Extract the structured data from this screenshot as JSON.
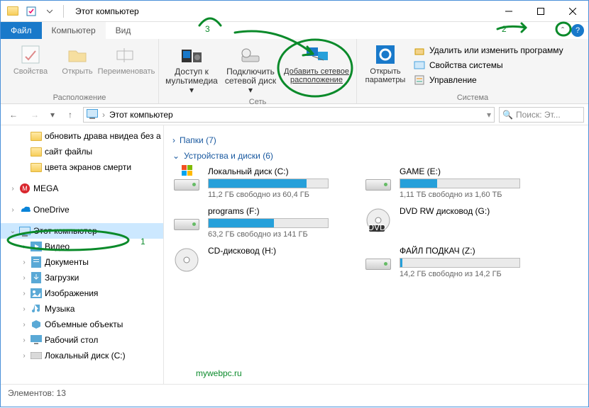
{
  "title": "Этот компьютер",
  "ribbonTabs": {
    "file": "Файл",
    "computer": "Компьютер",
    "view": "Вид"
  },
  "ribbon": {
    "group1": {
      "label": "Расположение",
      "props": "Свойства",
      "open": "Открыть",
      "rename": "Переименовать"
    },
    "group2": {
      "label": "Сеть",
      "media": "Доступ к мультимедиа",
      "mapdrive": "Подключить сетевой диск",
      "addloc": "Добавить сетевое расположение"
    },
    "group3": {
      "label": "Система",
      "settings": "Открыть параметры",
      "uninstall": "Удалить или изменить программу",
      "sysprops": "Свойства системы",
      "manage": "Управление"
    }
  },
  "address": {
    "path": "Этот компьютер",
    "searchPlaceholder": "Поиск: Эт..."
  },
  "tree": [
    {
      "label": "обновить драва нвидеа без а",
      "icon": "folder",
      "indent": 28
    },
    {
      "label": "сайт файлы",
      "icon": "folder",
      "indent": 28
    },
    {
      "label": "цвета экранов смерти",
      "icon": "folder",
      "indent": 28
    },
    {
      "label": "",
      "icon": "",
      "indent": 0
    },
    {
      "label": "MEGA",
      "icon": "mega",
      "indent": 12,
      "exp": "›"
    },
    {
      "label": "",
      "icon": "",
      "indent": 0
    },
    {
      "label": "OneDrive",
      "icon": "onedrive",
      "indent": 12,
      "exp": "›"
    },
    {
      "label": "",
      "icon": "",
      "indent": 0
    },
    {
      "label": "Этот компьютер",
      "icon": "pc",
      "indent": 12,
      "exp": "⌄",
      "sel": true
    },
    {
      "label": "Видео",
      "icon": "video",
      "indent": 28,
      "exp": "›"
    },
    {
      "label": "Документы",
      "icon": "docs",
      "indent": 28,
      "exp": "›"
    },
    {
      "label": "Загрузки",
      "icon": "down",
      "indent": 28,
      "exp": "›"
    },
    {
      "label": "Изображения",
      "icon": "pics",
      "indent": 28,
      "exp": "›"
    },
    {
      "label": "Музыка",
      "icon": "music",
      "indent": 28,
      "exp": "›"
    },
    {
      "label": "Объемные объекты",
      "icon": "3d",
      "indent": 28,
      "exp": "›"
    },
    {
      "label": "Рабочий стол",
      "icon": "desk",
      "indent": 28,
      "exp": "›"
    },
    {
      "label": "Локальный диск (C:)",
      "icon": "drive",
      "indent": 28,
      "exp": "›"
    }
  ],
  "sections": {
    "folders": "Папки (7)",
    "devices": "Устройства и диски (6)"
  },
  "devices": [
    {
      "name": "Локальный диск (C:)",
      "free": "11,2 ГБ свободно из 60,4 ГБ",
      "fill": 82,
      "bar": true,
      "icon": "win"
    },
    {
      "name": "GAME (E:)",
      "free": "1,11 ТБ свободно из 1,60 ТБ",
      "fill": 31,
      "bar": true,
      "icon": "drive"
    },
    {
      "name": "programs (F:)",
      "free": "63,2 ГБ свободно из 141 ГБ",
      "fill": 55,
      "bar": true,
      "icon": "drive"
    },
    {
      "name": "DVD RW дисковод (G:)",
      "free": "",
      "bar": false,
      "icon": "dvd"
    },
    {
      "name": "CD-дисковод (H:)",
      "free": "",
      "bar": false,
      "icon": "cd"
    },
    {
      "name": "ФАЙЛ ПОДКАЧ (Z:)",
      "free": "14,2 ГБ свободно из 14,2 ГБ",
      "fill": 2,
      "bar": true,
      "icon": "drive"
    }
  ],
  "status": "Элементов: 13",
  "annotations": {
    "one": "1",
    "two": "2",
    "three": "3",
    "watermark": "MYWEBPC.RU"
  }
}
